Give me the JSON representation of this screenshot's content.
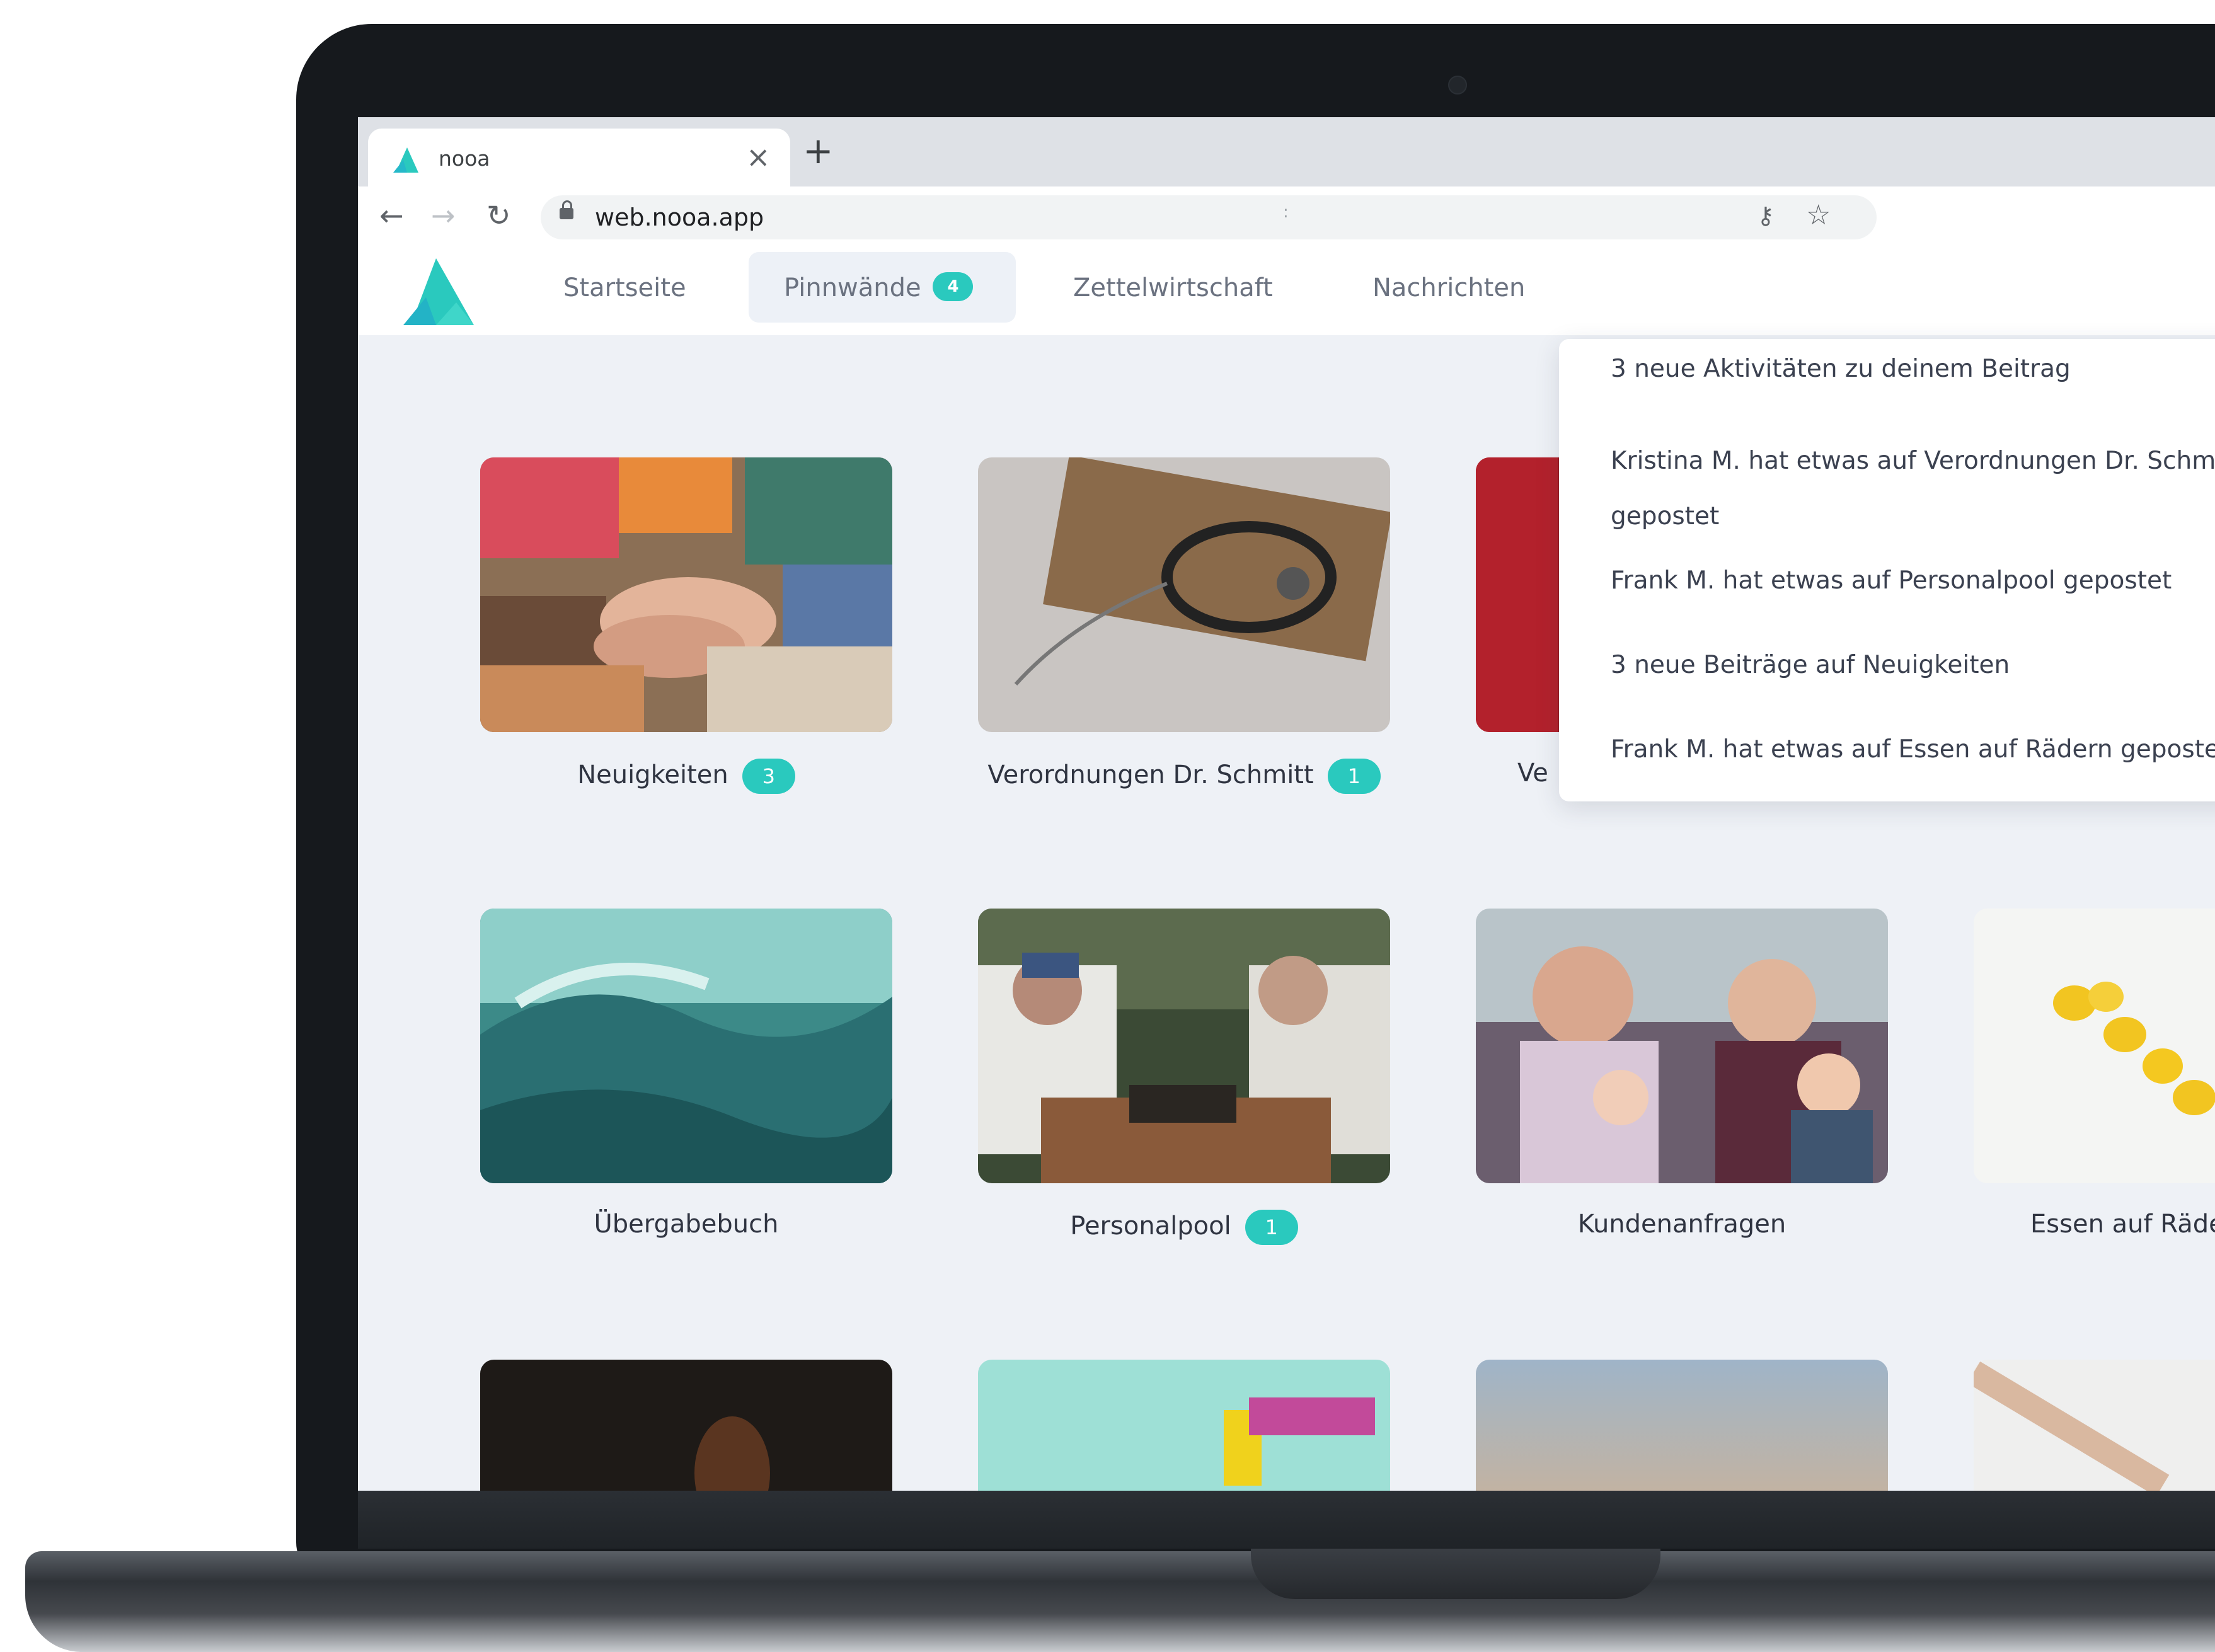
{
  "browser": {
    "tab_title": "nooa",
    "tab_close": "×",
    "new_tab": "+",
    "url": "web.nooa.app",
    "omnibox_mid": ":"
  },
  "nav": {
    "items": [
      {
        "label": "Startseite"
      },
      {
        "label": "Pinnwände",
        "badge": "4",
        "active": true
      },
      {
        "label": "Zettelwirtschaft"
      },
      {
        "label": "Nachrichten"
      }
    ]
  },
  "notifications": [
    {
      "line1": "3 neue Aktivitäten zu deinem Beitrag"
    },
    {
      "line1": "Kristina M. hat etwas auf Verordnungen Dr. Schm",
      "line2": "gepostet"
    },
    {
      "line1": "Frank M. hat etwas auf Personalpool gepostet"
    },
    {
      "line1": "3 neue Beiträge auf Neuigkeiten"
    },
    {
      "line1": "Frank M. hat etwas auf Essen auf Rädern geposte"
    }
  ],
  "boards": [
    {
      "label": "Neuigkeiten",
      "badge": "3"
    },
    {
      "label": "Verordnungen Dr. Schmitt",
      "badge": "1"
    },
    {
      "label": "Ve"
    },
    {
      "label": "Übergabebuch"
    },
    {
      "label": "Personalpool",
      "badge": "1"
    },
    {
      "label": "Kundenanfragen"
    },
    {
      "label": "Essen auf Räde"
    }
  ],
  "colors": {
    "accent": "#2ac9be",
    "page_background": "#eef1f6",
    "text": "#2f3441"
  },
  "icons": [
    "back-icon",
    "forward-icon",
    "reload-icon",
    "lock-icon",
    "key-icon",
    "star-icon",
    "close-icon",
    "nooa-logo"
  ]
}
